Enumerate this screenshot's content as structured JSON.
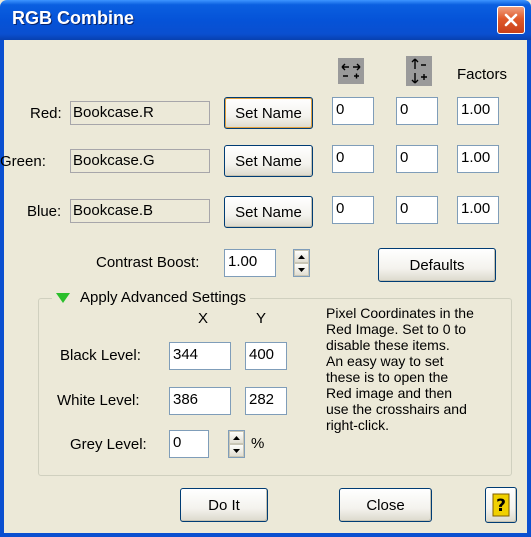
{
  "window": {
    "title": "RGB Combine"
  },
  "headers": {
    "factors": "Factors"
  },
  "channels": [
    {
      "label": "Red:",
      "name": "Bookcase.R",
      "button": "Set Name",
      "shift_x": "0",
      "shift_y": "0",
      "factor": "1.00"
    },
    {
      "label": "Green:",
      "name": "Bookcase.G",
      "button": "Set Name",
      "shift_x": "0",
      "shift_y": "0",
      "factor": "1.00"
    },
    {
      "label": "Blue:",
      "name": "Bookcase.B",
      "button": "Set Name",
      "shift_x": "0",
      "shift_y": "0",
      "factor": "1.00"
    }
  ],
  "contrast": {
    "label": "Contrast Boost:",
    "value": "1.00"
  },
  "defaults_label": "Defaults",
  "advanced": {
    "title": "Apply Advanced Settings",
    "col_x": "X",
    "col_y": "Y",
    "black": {
      "label": "Black Level:",
      "x": "344",
      "y": "400"
    },
    "white": {
      "label": "White Level:",
      "x": "386",
      "y": "282"
    },
    "grey": {
      "label": "Grey Level:",
      "value": "0",
      "unit": "%"
    },
    "info": "Pixel Coordinates in the\nRed Image.  Set to 0 to\ndisable these items.\n    An easy way to set\nthese is to open the\nRed image and then\nuse the crosshairs and\nright-click."
  },
  "buttons": {
    "do_it": "Do It",
    "close": "Close"
  },
  "colors": {
    "titlebar": "#0553d8",
    "accent_triangle": "#2bbf2b",
    "help_icon": "#f0d000"
  }
}
